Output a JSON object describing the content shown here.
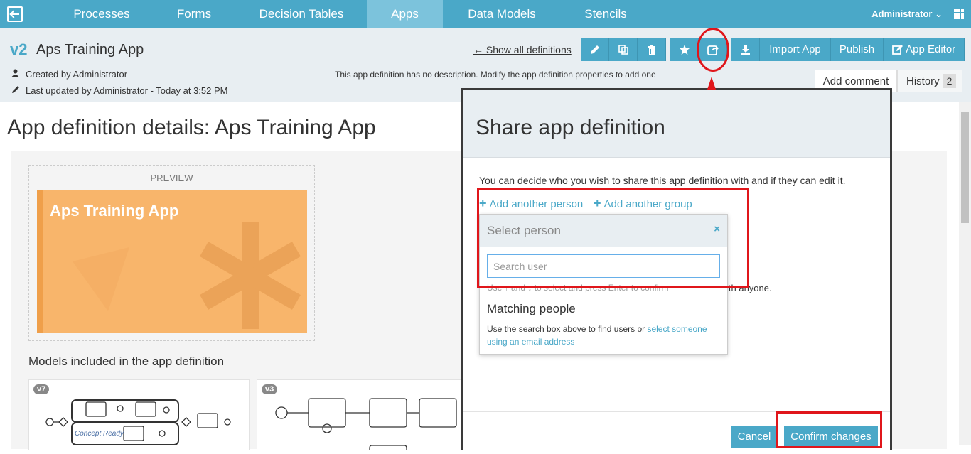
{
  "nav": {
    "tabs": [
      "Processes",
      "Forms",
      "Decision Tables",
      "Apps",
      "Data Models",
      "Stencils"
    ],
    "active_tab": "Apps",
    "user": "Administrator",
    "user_caret": "⌄"
  },
  "header": {
    "version": "v2",
    "app_name": "Aps Training App",
    "created_by": "Created by Administrator",
    "last_updated": "Last updated by Administrator - Today at 3:52 PM",
    "show_all": "← Show all definitions",
    "no_description": "This app definition has no description. Modify the app definition properties to add one",
    "buttons": {
      "import_app": "Import App",
      "publish": "Publish",
      "app_editor": "App Editor"
    },
    "add_comment": "Add comment",
    "history_label": "History",
    "history_count": "2"
  },
  "main": {
    "heading": "App definition details: Aps Training App",
    "preview_label": "PREVIEW",
    "preview_title": "Aps Training App",
    "models_title": "Models included in the app definition",
    "model_versions": [
      "v7",
      "v3"
    ],
    "model_label": "Concept Ready",
    "theme_color": "#f8b56b"
  },
  "modal": {
    "title": "Share app definition",
    "description": "You can decide who you wish to share this app definition with and if they can edit it.",
    "add_person": "Add another person",
    "add_group": "Add another group",
    "anyone_text": "ith anyone.",
    "cancel": "Cancel",
    "confirm": "Confirm changes"
  },
  "dropdown": {
    "title": "Select person",
    "close": "×",
    "placeholder": "Search user",
    "hint": "Use ↑ and ↓ to select and press Enter to confirm",
    "matching_title": "Matching people",
    "help_text": "Use the search box above to find users or ",
    "help_link": "select someone using an email address"
  },
  "colors": {
    "primary": "#4aa8c8",
    "header_bg": "#e8eef2",
    "annotation_red": "#e0161b",
    "tile_orange": "#f8b56b"
  }
}
